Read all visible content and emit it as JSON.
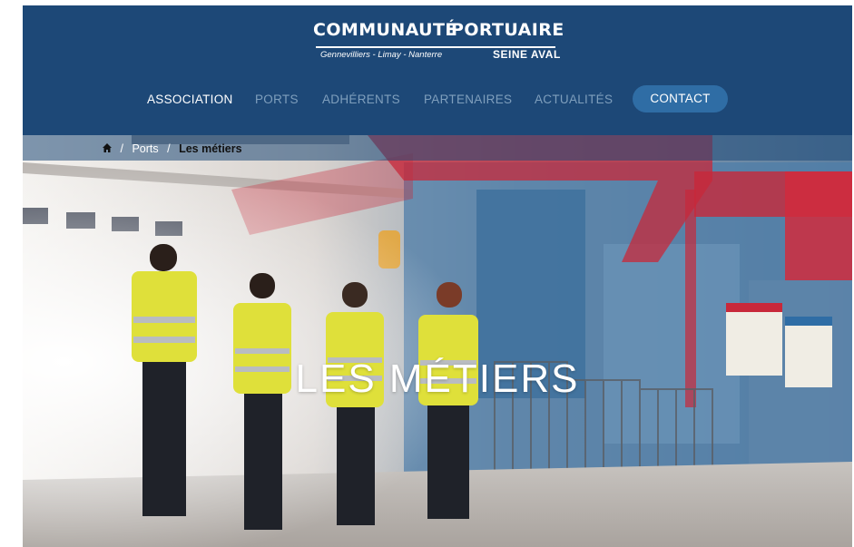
{
  "logo": {
    "line1": "COMMUNAUTÉ",
    "line2": "PORTUAIRE",
    "subtitle": "Gennevilliers - Limay - Nanterre",
    "region": "SEINE AVAL"
  },
  "nav": {
    "items": [
      {
        "label": "ASSOCIATION"
      },
      {
        "label": "PORTS"
      },
      {
        "label": "ADHÉRENTS"
      },
      {
        "label": "PARTENAIRES"
      },
      {
        "label": "ACTUALITÉS"
      }
    ],
    "contact_label": "CONTACT"
  },
  "breadcrumb": {
    "items": [
      "Ports",
      "Les métiers"
    ],
    "separator": "/"
  },
  "hero": {
    "title": "LES MÉTIERS"
  },
  "colors": {
    "header_bg": "#1d4877",
    "nav_inactive": "#7f9fbd",
    "nav_active": "#ffffff",
    "contact_bg": "#2f6da5",
    "accent_red": "#c8283a"
  }
}
